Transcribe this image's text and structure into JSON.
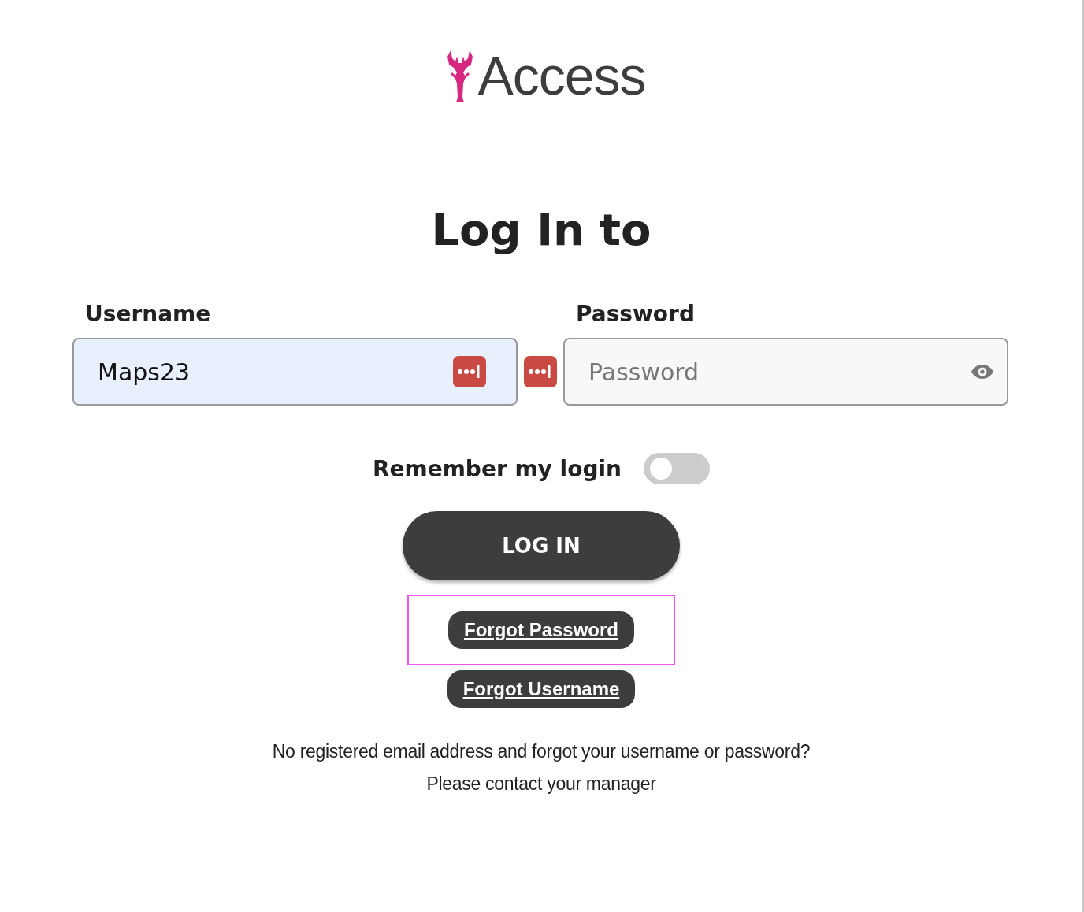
{
  "logo": {
    "text": "Access"
  },
  "heading": "Log In to",
  "username": {
    "label": "Username",
    "value": "Maps23",
    "autofilled": true
  },
  "password": {
    "label": "Password",
    "placeholder": "Password"
  },
  "remember": {
    "label": "Remember my login",
    "on": false
  },
  "login_button": "LOG IN",
  "links": [
    {
      "label": "Forgot Password",
      "focused": true
    },
    {
      "label": "Forgot Username",
      "focused": false
    }
  ],
  "note": [
    "No registered email address and forgot your username or password?",
    "Please contact your manager"
  ]
}
